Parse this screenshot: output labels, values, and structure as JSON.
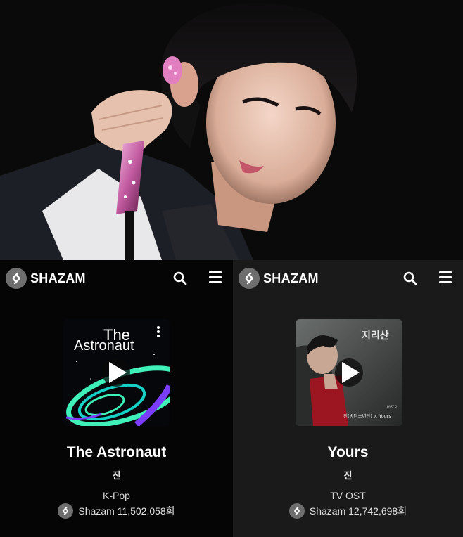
{
  "left_panel": {
    "brand": "SHAZAM",
    "song_title": "The Astronaut",
    "artist": "진",
    "genre": "K-Pop",
    "shazam_label": "Shazam",
    "count_text": "11,502,058회",
    "cover_text_line1": "The",
    "cover_text_line2": "Astronaut",
    "cover_colors": [
      "#3ff0b8",
      "#7a3cff",
      "#15d0c4"
    ]
  },
  "right_panel": {
    "brand": "SHAZAM",
    "song_title": "Yours",
    "artist": "진",
    "genre": "TV OST",
    "shazam_label": "Shazam",
    "count_text": "12,742,698회",
    "cover_title": "지리산",
    "cover_part": "PART 6",
    "cover_credit": "진(방탄소년단) × Yours"
  },
  "icons": {
    "logo": "shazam-logo-icon",
    "search": "search-icon",
    "menu": "hamburger-menu-icon",
    "play": "play-icon",
    "more": "more-vertical-icon"
  },
  "colors": {
    "left_bg": "#050505",
    "right_bg": "#1b1a1a",
    "logo_circle": "#6e6e6e"
  }
}
